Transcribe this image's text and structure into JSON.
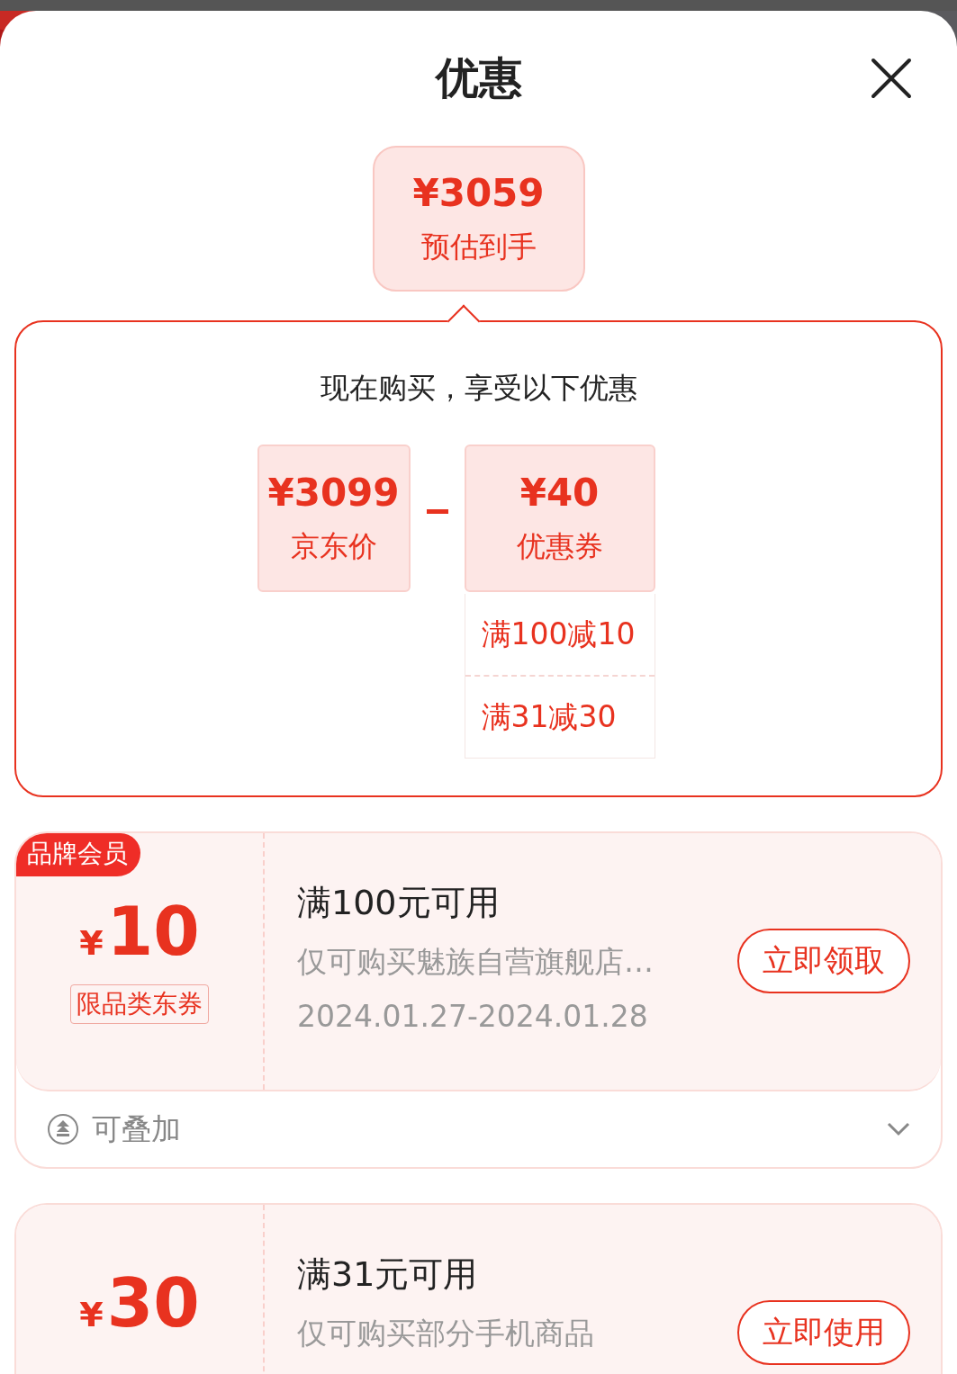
{
  "sheet": {
    "title": "优惠"
  },
  "estimate": {
    "price": "¥3059",
    "label": "预估到手"
  },
  "breakdown": {
    "heading": "现在购买，享受以下优惠",
    "price": {
      "amount": "¥3099",
      "label": "京东价"
    },
    "discount": {
      "amount": "¥40",
      "label": "优惠券"
    },
    "details": [
      "满100减10",
      "满31减30"
    ]
  },
  "coupons": [
    {
      "badge": "品牌会员",
      "symbol": "¥",
      "amount": "10",
      "tag": "限品类东券",
      "condition": "满100元可用",
      "scope": "仅可购买魅族自营旗舰店…",
      "validity": "2024.01.27-2024.01.28",
      "action": "立即领取",
      "footer": {
        "label": "可叠加"
      }
    },
    {
      "symbol": "¥",
      "amount": "30",
      "condition": "满31元可用",
      "scope": "仅可购买部分手机商品",
      "action": "立即使用"
    }
  ]
}
